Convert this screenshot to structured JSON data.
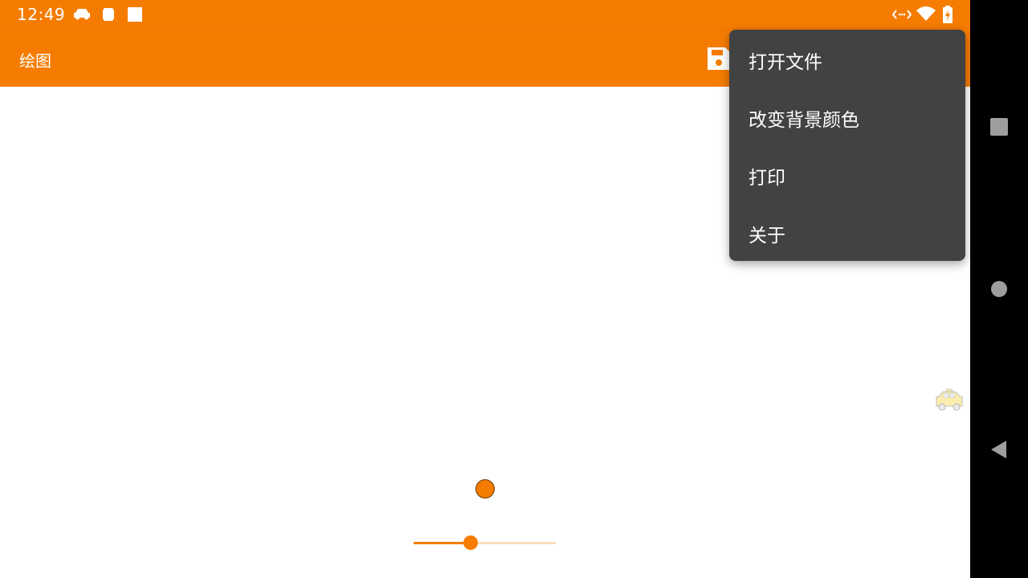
{
  "status_bar": {
    "time": "12:49",
    "icons": [
      "car-icon",
      "shield-icon",
      "square-icon",
      "data-arrows-icon",
      "wifi-icon",
      "battery-charging-icon"
    ]
  },
  "app_bar": {
    "title": "绘图",
    "action_icon": "save-icon"
  },
  "overflow_menu": {
    "items": [
      {
        "label": "打开文件"
      },
      {
        "label": "改变背景颜色"
      },
      {
        "label": "打印"
      },
      {
        "label": "关于"
      }
    ]
  },
  "drawing": {
    "brush_color": "#f57c00",
    "brush_size_fraction": 0.4
  },
  "navigation_bar": {
    "buttons": [
      "recents-icon",
      "home-icon",
      "back-icon"
    ]
  },
  "colors": {
    "accent": "#f57c00",
    "menu_bg": "#424242"
  }
}
